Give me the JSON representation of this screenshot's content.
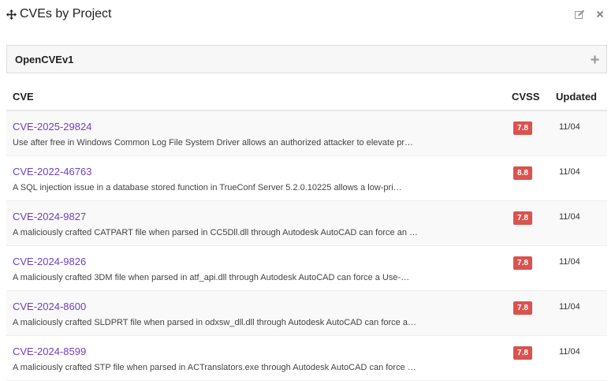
{
  "widget": {
    "title": "CVEs by Project",
    "icons": {
      "move": "move-arrows-icon",
      "edit": "edit-icon",
      "close": "close-icon"
    }
  },
  "project": {
    "name": "OpenCVEv1",
    "add_icon": "plus-icon"
  },
  "table": {
    "headers": {
      "cve": "CVE",
      "cvss": "CVSS",
      "updated": "Updated"
    },
    "rows": [
      {
        "id": "CVE-2025-29824",
        "description": "Use after free in Windows Common Log File System Driver allows an authorized attacker to elevate pr…",
        "cvss": "7.8",
        "updated": "11/04"
      },
      {
        "id": "CVE-2022-46763",
        "description": "A SQL injection issue in a database stored function in TrueConf Server 5.2.0.10225 allows a low-pri…",
        "cvss": "8.8",
        "updated": "11/04"
      },
      {
        "id": "CVE-2024-9827",
        "description": "A maliciously crafted CATPART file when parsed in CC5Dll.dll through Autodesk AutoCAD can force an …",
        "cvss": "7.8",
        "updated": "11/04"
      },
      {
        "id": "CVE-2024-9826",
        "description": "A maliciously crafted 3DM file when parsed in atf_api.dll through Autodesk AutoCAD can force a Use-…",
        "cvss": "7.8",
        "updated": "11/04"
      },
      {
        "id": "CVE-2024-8600",
        "description": "A maliciously crafted SLDPRT file when parsed in odxsw_dll.dll through Autodesk AutoCAD can force a…",
        "cvss": "7.8",
        "updated": "11/04"
      },
      {
        "id": "CVE-2024-8599",
        "description": "A maliciously crafted STP file when parsed in ACTranslators.exe through Autodesk AutoCAD can force …",
        "cvss": "7.8",
        "updated": "11/04"
      }
    ]
  },
  "colors": {
    "link": "#6f42c1",
    "badge_high": "#d9534f"
  }
}
